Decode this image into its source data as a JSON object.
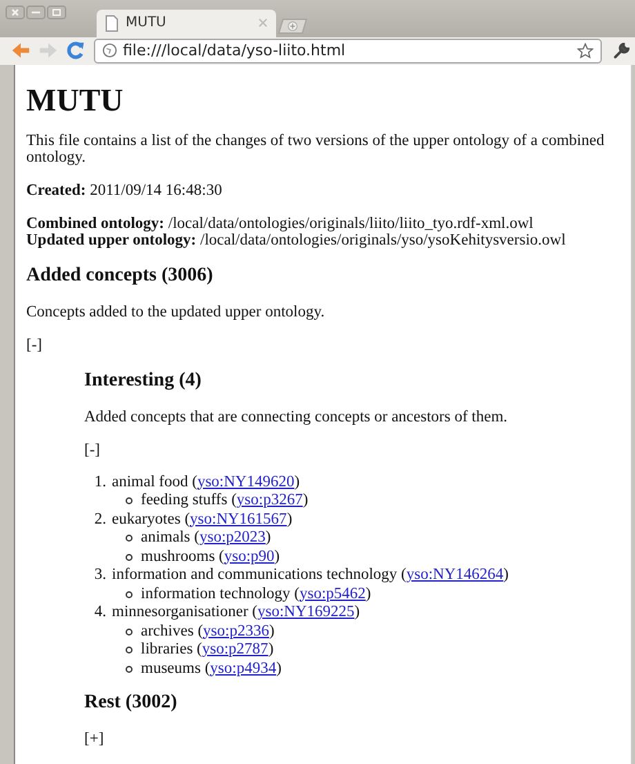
{
  "window": {
    "tab": {
      "title": "MUTU",
      "selected": true
    },
    "address": "file:///local/data/yso-liito.html",
    "back_disabled": false,
    "forward_disabled": true
  },
  "page": {
    "title": "MUTU",
    "intro": "This file contains a list of the changes of two versions of the upper ontology of a combined ontology.",
    "created": "**Created:** 2011/09/14 16:48:30",
    "combined": "**Combined ontology:** /local/data/ontologies/originals/liito/liito_tyo.rdf-xml.owl",
    "updated": "**Updated upper ontology:** /local/data/ontologies/originals/yso/ysoKehitysversio.owl",
    "section": {
      "heading": "Added concepts (3006)",
      "description": "Concepts added to the updated upper ontology.",
      "toggle": "[-]",
      "subsections": [
        {
          "heading": "Interesting (4)",
          "description": "Added concepts that are connecting concepts or ancestors of them.",
          "toggle": "[-]",
          "items": [
            {
              "number": "1.",
              "text": "animal food (",
              "link": "yso:NY149620",
              "close": ")",
              "children": [
                {
                  "text": "feeding stuffs (",
                  "link": "yso:p3267",
                  "close": ")"
                }
              ]
            },
            {
              "number": "2.",
              "text": "eukaryotes (",
              "link": "yso:NY161567",
              "close": ")",
              "children": [
                {
                  "text": "animals (",
                  "link": "yso:p2023",
                  "close": ")"
                },
                {
                  "text": "mushrooms (",
                  "link": "yso:p90",
                  "close": ")"
                }
              ]
            },
            {
              "number": "3.",
              "text": "information and communications technology (",
              "link": "yso:NY146264",
              "close": ")",
              "children": [
                {
                  "text": "information technology (",
                  "link": "yso:p5462",
                  "close": ")"
                }
              ]
            },
            {
              "number": "4.",
              "text": "minnesorganisationer (",
              "link": "yso:NY169225",
              "close": ")",
              "children": [
                {
                  "text": "archives (",
                  "link": "yso:p2336",
                  "close": ")"
                },
                {
                  "text": "libraries (",
                  "link": "yso:p2787",
                  "close": ")"
                },
                {
                  "text": "museums (",
                  "link": "yso:p4934",
                  "close": ")"
                }
              ]
            }
          ]
        },
        {
          "heading": "Rest (3002)",
          "toggle": "[+]"
        }
      ]
    }
  }
}
